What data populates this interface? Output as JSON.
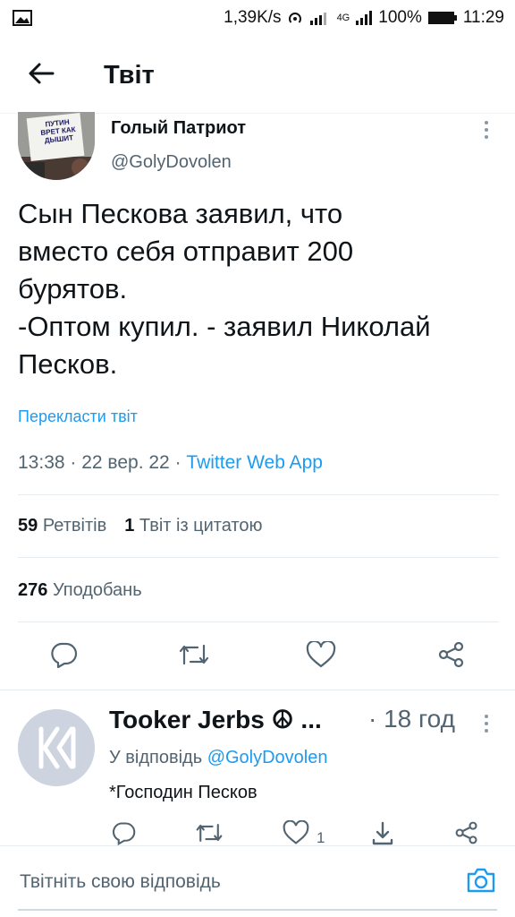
{
  "status_bar": {
    "speed": "1,39K/s",
    "battery": "100%",
    "time": "11:29",
    "network": "4G"
  },
  "app_bar": {
    "title": "Твіт"
  },
  "tweet": {
    "author_name": "Голый Патриот",
    "author_handle": "@GolyDovolen",
    "avatar_sign_text": "ПУТИН ВРЕТ КАК ДЫШИТ",
    "text": "Сын Пескова заявил, что\nвместо себя отправит 200\nбурятов.\n-Оптом купил. - заявил Николай\nПесков.",
    "translate_label": "Перекласти твіт",
    "time": "13:38",
    "date": "22 вер. 22",
    "source": "Twitter Web App",
    "separator": " · ",
    "retweets_count": "59",
    "retweets_label": "Ретвітів",
    "quotes_count": "1",
    "quotes_label": "Твіт із цитатою",
    "likes_count": "276",
    "likes_label": "Уподобань"
  },
  "reply": {
    "author_name": "Tooker Jerbs ☮ ...",
    "time": "· 18 год",
    "reply_to_label": "У відповідь",
    "reply_to_handle": "@GolyDovolen",
    "text": "*Господин Песков",
    "like_count": "1"
  },
  "compose": {
    "placeholder": "Твітніть свою відповідь"
  },
  "colors": {
    "accent": "#1d9bf0",
    "text_primary": "#0f1419",
    "text_secondary": "#536471",
    "divider": "#e6ecf0"
  },
  "icons": [
    "image-icon",
    "hotspot-icon",
    "signal-icon",
    "battery-icon",
    "back-arrow-icon",
    "more-vertical-icon",
    "reply-icon",
    "retweet-icon",
    "like-icon",
    "share-icon",
    "camera-icon"
  ]
}
